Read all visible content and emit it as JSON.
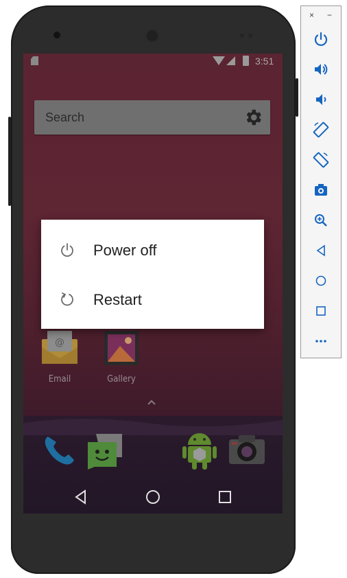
{
  "statusbar": {
    "time": "3:51"
  },
  "search": {
    "placeholder": "Search"
  },
  "apps": [
    {
      "label": "Email"
    },
    {
      "label": "Gallery"
    }
  ],
  "dialog": {
    "items": [
      {
        "label": "Power off",
        "icon": "power-icon"
      },
      {
        "label": "Restart",
        "icon": "restart-icon"
      }
    ]
  },
  "dock": {
    "icons": [
      "phone-icon",
      "messenger-icon",
      "android-store-icon",
      "camera-icon"
    ]
  },
  "navbar": {
    "icons": [
      "back-icon",
      "home-icon",
      "recents-icon"
    ]
  },
  "toolbar": {
    "close": "×",
    "minimize": "−",
    "buttons": [
      "power-icon",
      "volume-up-icon",
      "volume-down-icon",
      "rotate-left-icon",
      "rotate-right-icon",
      "screenshot-icon",
      "zoom-icon",
      "back-icon",
      "home-icon",
      "overview-icon",
      "more-icon"
    ]
  },
  "colors": {
    "dialog_bg": "#ffffff",
    "screen_tint": "#5b2432",
    "toolbar_icon": "#1565c0"
  }
}
